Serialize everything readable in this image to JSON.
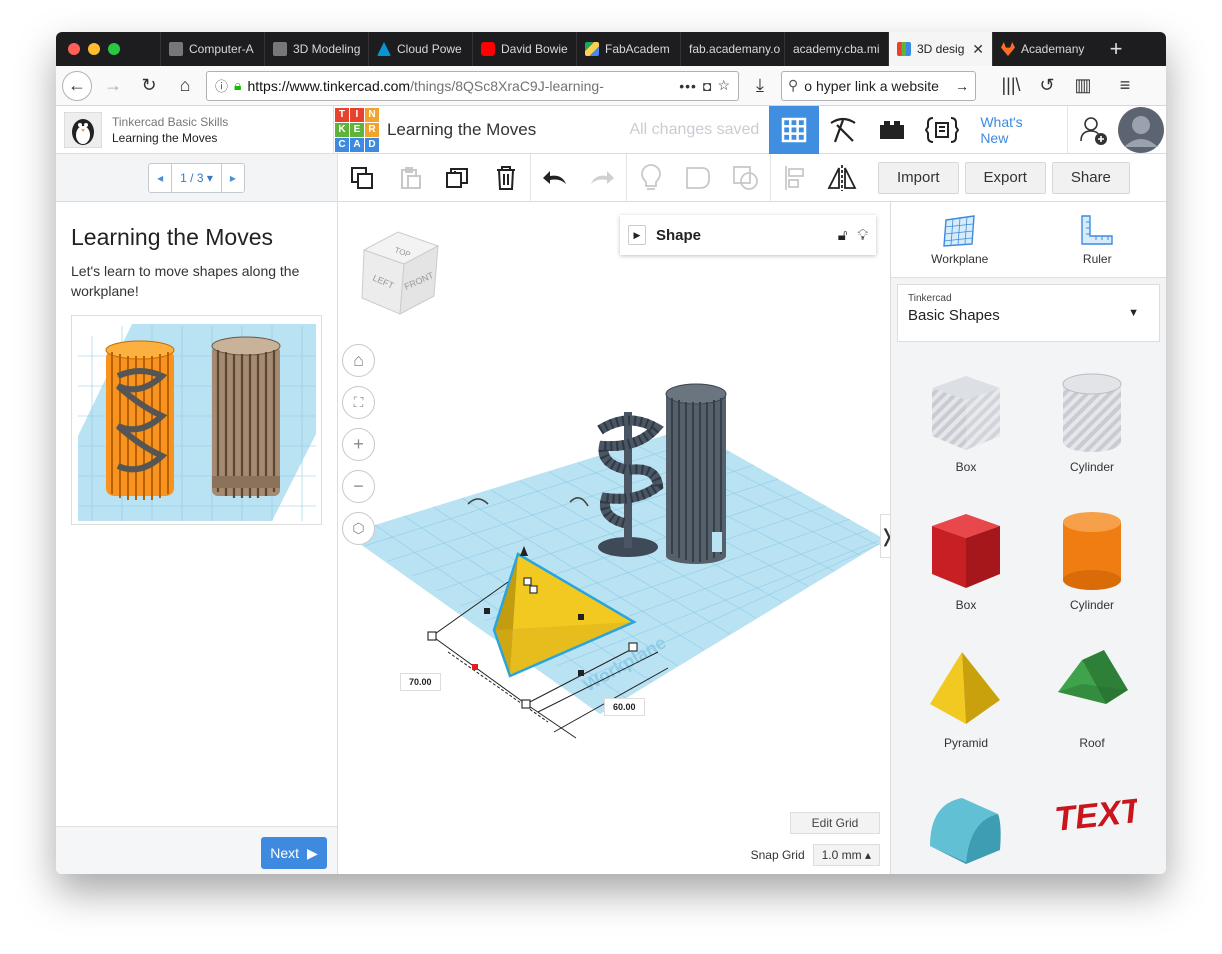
{
  "browser": {
    "tabs": [
      {
        "label": "Computer-A",
        "icon": "tinkercad-app-icon",
        "color": "#888888"
      },
      {
        "label": "3D Modeling",
        "icon": "tinkercad-app-icon",
        "color": "#888888"
      },
      {
        "label": "Cloud Powe",
        "icon": "autodesk-icon",
        "color": "#0696d7"
      },
      {
        "label": "David Bowie",
        "icon": "youtube-icon",
        "color": "#ff0000"
      },
      {
        "label": "FabAcadem",
        "icon": "google-drive-icon",
        "color": "#1fa463"
      },
      {
        "label": "fab.academany.o",
        "icon": "",
        "color": ""
      },
      {
        "label": "academy.cba.mi",
        "icon": "",
        "color": ""
      },
      {
        "label": "3D desig",
        "icon": "tinkercad-icon",
        "color": "#e8412c",
        "active": true
      },
      {
        "label": "Academany",
        "icon": "gitlab-icon",
        "color": "#fc6d26"
      }
    ],
    "url_host": "https://www.tinkercad.com",
    "url_path": "/things/8QSc8XraC9J-learning-",
    "search_text": "o hyper link a website"
  },
  "header": {
    "lesson_course": "Tinkercad Basic Skills",
    "lesson_title": "Learning the Moves",
    "logo_letters": [
      "T",
      "I",
      "N",
      "K",
      "E",
      "R",
      "C",
      "A",
      "D"
    ],
    "design_title": "Learning the Moves",
    "save_status": "All changes saved",
    "whats_new": "What's New"
  },
  "pager": {
    "label": "1 / 3"
  },
  "toolbar": {
    "import": "Import",
    "export": "Export",
    "share": "Share"
  },
  "lesson": {
    "title": "Learning the Moves",
    "description": "Let's learn to move shapes along the workplane!",
    "next": "Next"
  },
  "canvas": {
    "shape_panel_title": "Shape",
    "view_cube": {
      "top": "TOP",
      "left": "LEFT",
      "front": "FRONT"
    },
    "dim_length": "70.00",
    "dim_width": "60.00",
    "workplane_label": "Workplane",
    "edit_grid": "Edit Grid",
    "snap_grid_label": "Snap Grid",
    "snap_grid_value": "1.0 mm"
  },
  "rightpanel": {
    "workplane": "Workplane",
    "ruler": "Ruler",
    "library_brand": "Tinkercad",
    "library_name": "Basic Shapes",
    "shapes": [
      {
        "name": "Box",
        "kind": "hole-box"
      },
      {
        "name": "Cylinder",
        "kind": "hole-cylinder"
      },
      {
        "name": "Box",
        "kind": "box"
      },
      {
        "name": "Cylinder",
        "kind": "cylinder"
      },
      {
        "name": "Pyramid",
        "kind": "pyramid"
      },
      {
        "name": "Roof",
        "kind": "roof"
      },
      {
        "name": "",
        "kind": "round-roof"
      },
      {
        "name": "",
        "kind": "text"
      }
    ],
    "text_shape_label": "TEXT"
  },
  "colors": {
    "accent": "#3d8ae0",
    "workplane": "#bfe4f5",
    "pyramid": "#f2c921",
    "box_red": "#d42a2a",
    "cylinder_orange": "#ef7d12",
    "roof_green": "#3ea34a",
    "roundroof_teal": "#62c0d4"
  }
}
